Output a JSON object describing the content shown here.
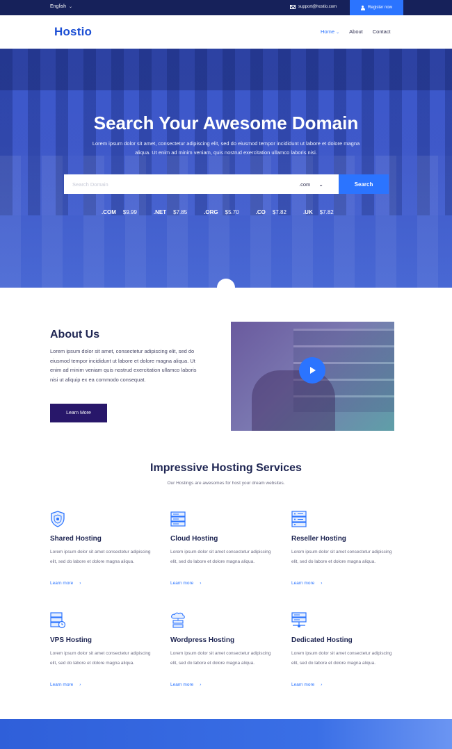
{
  "topbar": {
    "language": "English",
    "email": "support@hostio.com",
    "register": "Register now"
  },
  "nav": {
    "logo": "Hostio",
    "items": [
      "Home",
      "About",
      "Contact"
    ]
  },
  "hero": {
    "title": "Search Your Awesome Domain",
    "lead": "Lorem ipsum dolor sit amet, consectetur adipiscing elit, sed do eiusmod tempor incididunt ut labore et dolore magna aliqua. Ut enim ad minim veniam, quis nostrud exercitation ullamco laboris nisi.",
    "search_placeholder": "Search Domain",
    "tld_selected": ".com",
    "search_button": "Search",
    "prices": [
      {
        "tld": ".COM",
        "price": "$9.99"
      },
      {
        "tld": ".NET",
        "price": "$7.85"
      },
      {
        "tld": ".ORG",
        "price": "$5.70"
      },
      {
        "tld": ".CO",
        "price": "$7.82"
      },
      {
        "tld": ".UK",
        "price": "$7.82"
      }
    ]
  },
  "about": {
    "title": "About Us",
    "text": "Lorem ipsum dolor sit amet, consectetur adipiscing elit, sed do eiusmod tempor incididunt ut labore et dolore magna aliqua. Ut enim ad minim veniam quis nostrud exercitation ullamco laboris nisi ut aliquip ex ea commodo consequat.",
    "button": "Learn More"
  },
  "services": {
    "title": "Impressive Hosting Services",
    "subtitle": "Our Hostings are awesomes for host your dream websites.",
    "items": [
      {
        "name": "Shared Hosting",
        "icon": "shield-icon",
        "desc": "Lorem ipsum dolor sit amet consectetur adipiscing elit, sed do labore et dolore magna aliqua.",
        "more": "Learn more"
      },
      {
        "name": "Cloud Hosting",
        "icon": "server-icon",
        "desc": "Lorem ipsum dolor sit amet consectetur adipiscing elit, sed do labore et dolore magna aliqua.",
        "more": "Learn more"
      },
      {
        "name": "Reseller Hosting",
        "icon": "server-rack-icon",
        "desc": "Lorem ipsum dolor sit amet consectetur adipiscing elit, sed do labore et dolore magna aliqua.",
        "more": "Learn more"
      },
      {
        "name": "VPS Hosting",
        "icon": "server-clock-icon",
        "desc": "Lorem ipsum dolor sit amet consectetur adipiscing elit, sed do labore et dolore magna aliqua.",
        "more": "Learn more"
      },
      {
        "name": "Wordpress Hosting",
        "icon": "cloud-server-icon",
        "desc": "Lorem ipsum dolor sit amet consectetur adipiscing elit, sed do labore et dolore magna aliqua.",
        "more": "Learn more"
      },
      {
        "name": "Dedicated Hosting",
        "icon": "network-server-icon",
        "desc": "Lorem ipsum dolor sit amet consectetur adipiscing elit, sed do labore et dolore magna aliqua.",
        "more": "Learn more"
      }
    ]
  },
  "colors": {
    "accent": "#2b74ff",
    "topbar": "#16215a",
    "button_dark": "#28176a",
    "heading": "#1e2552"
  }
}
